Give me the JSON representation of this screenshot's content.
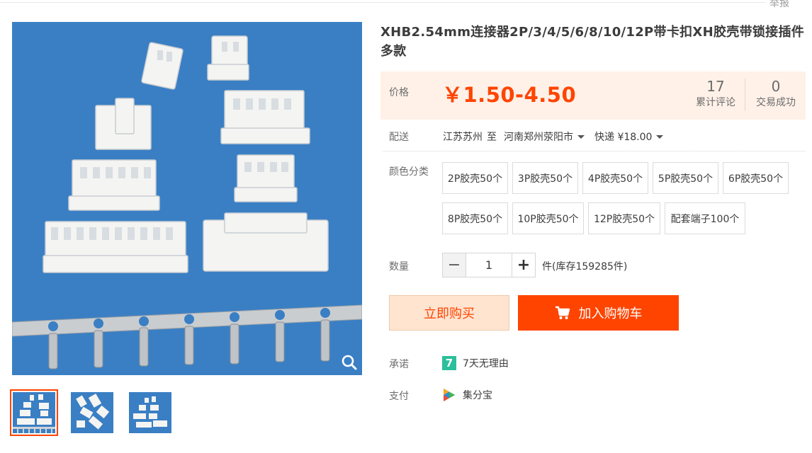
{
  "header": {
    "report_label": "举报"
  },
  "product": {
    "title": "XHB2.54mm连接器2P/3/4/5/6/8/10/12P带卡扣XH胶壳带锁接插件多款",
    "price_label": "价格",
    "price": "￥1.50-4.50",
    "reviews": {
      "count": "17",
      "label": "累计评论"
    },
    "transactions": {
      "count": "0",
      "label": "交易成功"
    }
  },
  "shipping": {
    "label": "配送",
    "from": "江苏苏州",
    "to_word": "至",
    "destination": "河南郑州荥阳市",
    "method": "快递 ¥18.00"
  },
  "variants": {
    "label": "颜色分类",
    "options": [
      "2P胶壳50个",
      "3P胶壳50个",
      "4P胶壳50个",
      "5P胶壳50个",
      "6P胶壳50个",
      "8P胶壳50个",
      "10P胶壳50个",
      "12P胶壳50个",
      "配套端子100个"
    ]
  },
  "quantity": {
    "label": "数量",
    "minus": "−",
    "plus": "+",
    "value": "1",
    "stock_text": "件(库存159285件)"
  },
  "actions": {
    "buy_now": "立即购买",
    "add_to_cart": "加入购物车"
  },
  "promise": {
    "label": "承诺",
    "icon_text": "7",
    "text": "7天无理由"
  },
  "payment": {
    "label": "支付",
    "text": "集分宝"
  },
  "colors": {
    "accent": "#ff4400",
    "price_bg": "#fff1e8",
    "image_bg": "#3a7fc4"
  }
}
